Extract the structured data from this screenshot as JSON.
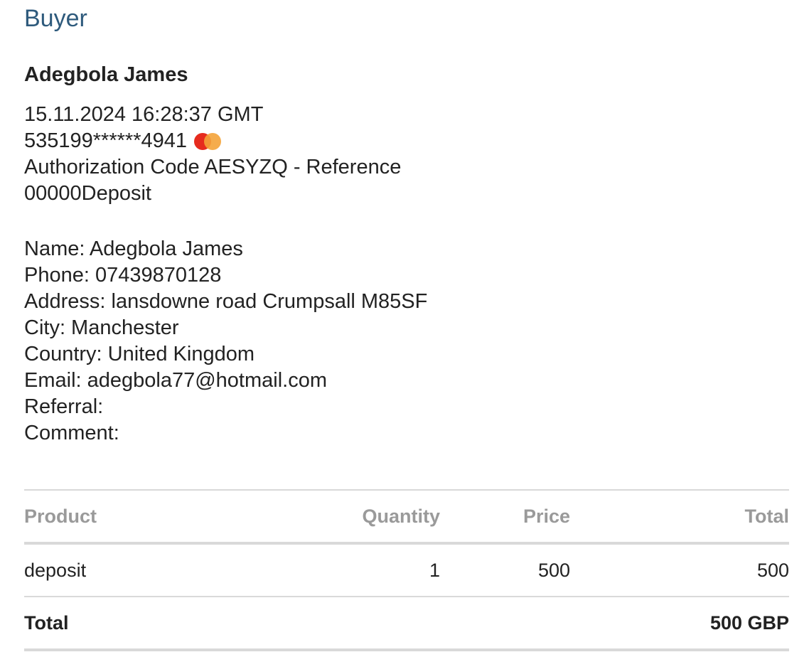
{
  "section": {
    "title": "Buyer"
  },
  "buyer": {
    "name": "Adegbola James",
    "datetime": "15.11.2024 16:28:37 GMT",
    "card_number": "535199******4941",
    "card_brand_icon": "mastercard-icon",
    "auth_line": "Authorization Code AESYZQ - Reference",
    "reference_line": "00000Deposit"
  },
  "details": {
    "name": "Name: Adegbola James",
    "phone": "Phone: 07439870128",
    "address": "Address: lansdowne road Crumpsall M85SF",
    "city": "City: Manchester",
    "country": "Country: United Kingdom",
    "email": "Email: adegbola77@hotmail.com",
    "referral": "Referral:",
    "comment": "Comment:"
  },
  "table": {
    "headers": {
      "product": "Product",
      "quantity": "Quantity",
      "price": "Price",
      "total": "Total"
    },
    "rows": [
      {
        "product": "deposit",
        "quantity": "1",
        "price": "500",
        "total": "500"
      }
    ],
    "footer": {
      "label": "Total",
      "value": "500 GBP"
    }
  },
  "colors": {
    "title": "#2e5a7c",
    "mastercard_red": "#e62b1e",
    "mastercard_orange": "#f4a338"
  }
}
